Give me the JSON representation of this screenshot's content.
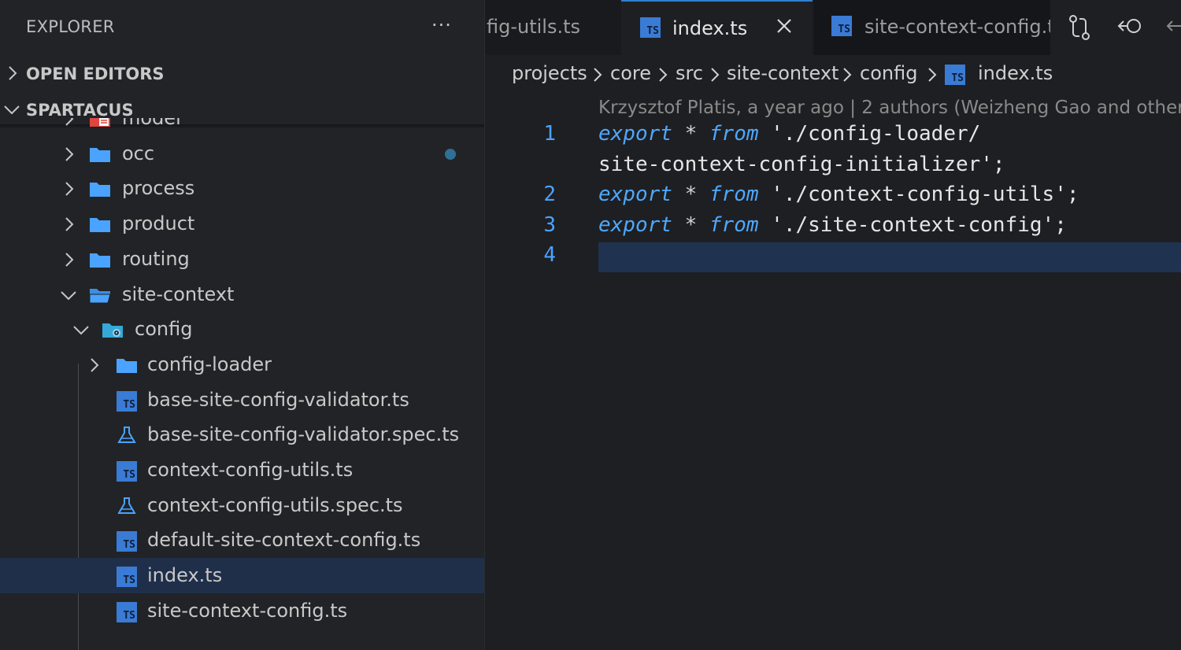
{
  "sidebar": {
    "title": "EXPLORER",
    "more": "···",
    "sections": {
      "open_editors": "OPEN EDITORS",
      "workspace": "SPARTACUS"
    },
    "tree": [
      {
        "name": "model",
        "type": "folder-special",
        "depth": 1,
        "expanded": false
      },
      {
        "name": "occ",
        "type": "folder",
        "depth": 1,
        "expanded": false,
        "modified": true
      },
      {
        "name": "process",
        "type": "folder",
        "depth": 1,
        "expanded": false
      },
      {
        "name": "product",
        "type": "folder",
        "depth": 1,
        "expanded": false
      },
      {
        "name": "routing",
        "type": "folder",
        "depth": 1,
        "expanded": false
      },
      {
        "name": "site-context",
        "type": "folder-open",
        "depth": 1,
        "expanded": true
      },
      {
        "name": "config",
        "type": "folder-config",
        "depth": 2,
        "expanded": true
      },
      {
        "name": "config-loader",
        "type": "folder",
        "depth": 3,
        "expanded": false
      },
      {
        "name": "base-site-config-validator.ts",
        "type": "ts",
        "depth": 3
      },
      {
        "name": "base-site-config-validator.spec.ts",
        "type": "spec",
        "depth": 3
      },
      {
        "name": "context-config-utils.ts",
        "type": "ts",
        "depth": 3
      },
      {
        "name": "context-config-utils.spec.ts",
        "type": "spec",
        "depth": 3
      },
      {
        "name": "default-site-context-config.ts",
        "type": "ts",
        "depth": 3
      },
      {
        "name": "index.ts",
        "type": "ts",
        "depth": 3,
        "selected": true
      },
      {
        "name": "site-context-config.ts",
        "type": "ts",
        "depth": 3
      }
    ]
  },
  "tabs": [
    {
      "label": "fig-utils.ts",
      "active": false
    },
    {
      "label": "index.ts",
      "active": true
    },
    {
      "label": "site-context-config.t",
      "active": false
    }
  ],
  "breadcrumb": [
    "projects",
    "core",
    "src",
    "site-context",
    "config",
    "index.ts"
  ],
  "blame": "Krzysztof Platis, a year ago | 2 authors (Weizheng Gao and other",
  "code": {
    "lines": [
      {
        "number": "1",
        "keyword": "export",
        "op": "*",
        "from": "from",
        "path": "'./config-loader/",
        "cont": "site-context-config-initializer';"
      },
      {
        "number": "2",
        "keyword": "export",
        "op": "*",
        "from": "from",
        "path": "'./context-config-utils';"
      },
      {
        "number": "3",
        "keyword": "export",
        "op": "*",
        "from": "from",
        "path": "'./site-context-config';"
      },
      {
        "number": "4"
      }
    ]
  },
  "colors": {
    "accent": "#2f7fd1",
    "keyword": "#4ea8ff",
    "folder": "#4aa3ff",
    "selection": "#1f2f4a"
  }
}
